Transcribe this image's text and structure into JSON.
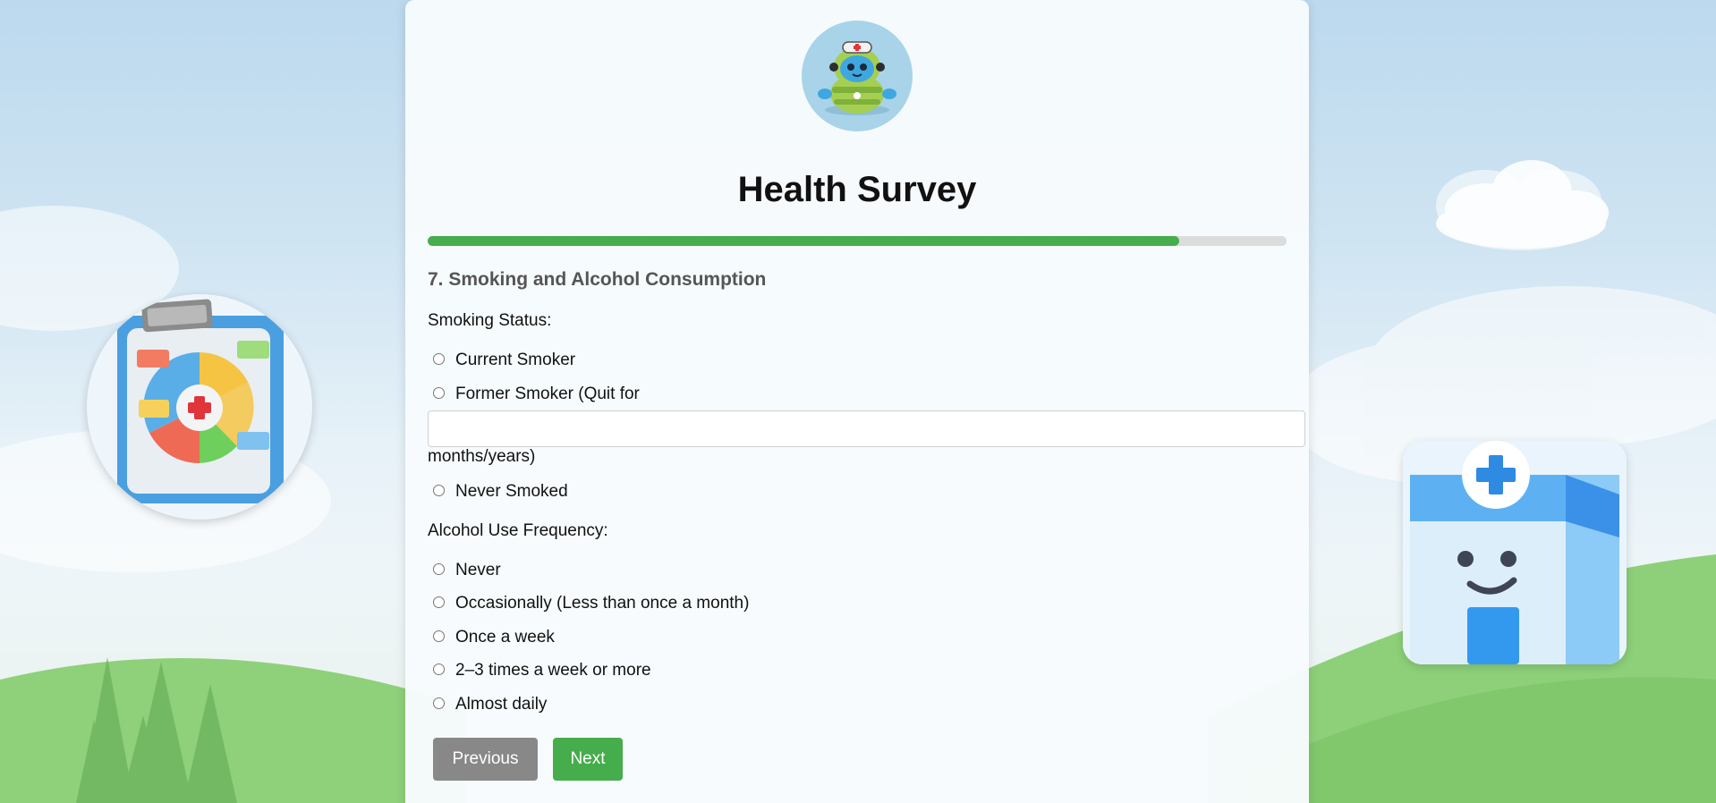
{
  "survey": {
    "title": "Health Survey",
    "progress_fraction": 0.875,
    "section_title": "7. Smoking and Alcohol Consumption",
    "smoking": {
      "label": "Smoking Status:",
      "options": {
        "current": "Current Smoker",
        "former": "Former Smoker (Quit for",
        "former_suffix": "months/years)",
        "never": "Never Smoked"
      },
      "quit_input_value": ""
    },
    "alcohol": {
      "label": "Alcohol Use Frequency:",
      "options": {
        "never": "Never",
        "occasionally": "Occasionally (Less than once a month)",
        "weekly": "Once a week",
        "two_three": "2–3 times a week or more",
        "daily": "Almost daily"
      }
    },
    "buttons": {
      "previous": "Previous",
      "next": "Next"
    }
  },
  "colors": {
    "accent_green": "#45ad4b",
    "previous_gray": "#888888",
    "progress_track": "#dcdcdc"
  },
  "icons": {
    "avatar": "robot-nurse-icon",
    "left_decoration": "clipboard-chart-icon",
    "right_decoration": "smiling-clinic-icon"
  }
}
